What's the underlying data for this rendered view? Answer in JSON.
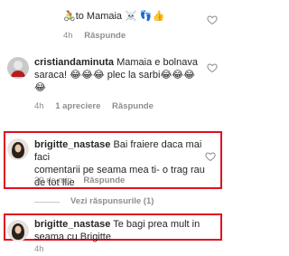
{
  "comment0": {
    "text": "🚴to Mamaia ☠️ 👣👍",
    "time": "4h",
    "reply": "Răspunde"
  },
  "comment1": {
    "username": "cristiandaminuta",
    "line1": "Mamaia e bolnava",
    "line2": "saraca! 😂😂😂 plec la sarbi😂😂😂",
    "line3": "😂",
    "time": "4h",
    "likes": "1 apreciere",
    "reply": "Răspunde"
  },
  "comment2": {
    "username": "brigitte_nastase",
    "line1": "Bai fraiere daca mai faci",
    "line2": "comentarii pe seama mea ti- o trag rau",
    "line3": "de tot Ilie",
    "time": "30 de min",
    "reply": "Răspunde"
  },
  "view_replies": "Vezi răspunsurile (1)",
  "comment3": {
    "username": "brigitte_nastase",
    "line1": "Te bagi prea mult in",
    "line2": "seama cu Brigitte",
    "time": "4h"
  },
  "colors": {
    "highlight_border": "#e0101f",
    "meta_text": "#8e8e8e"
  }
}
